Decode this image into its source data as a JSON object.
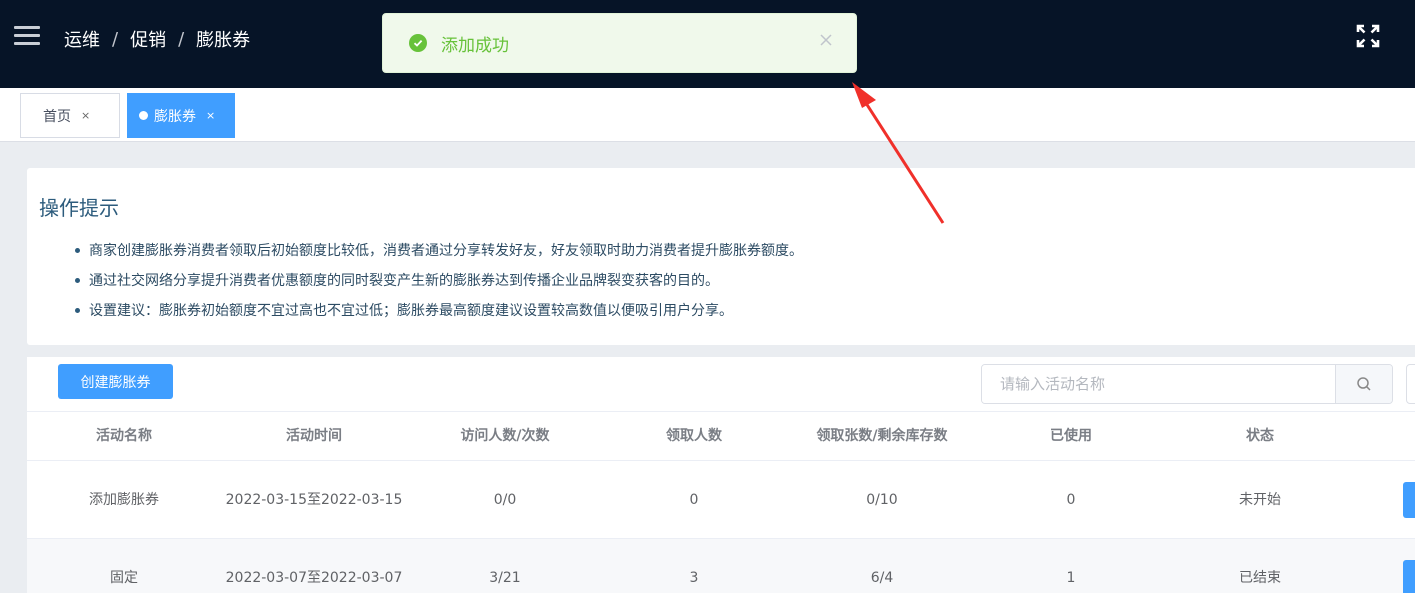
{
  "header": {
    "breadcrumb": [
      "运维",
      "促销",
      "膨胀券"
    ],
    "separator": "/",
    "bg_color": "#061427"
  },
  "toast": {
    "message": "添加成功",
    "type": "success",
    "color": "#67c23a"
  },
  "tabs": [
    {
      "label": "首页",
      "close": "×",
      "active": false
    },
    {
      "label": "膨胀券",
      "close": "×",
      "active": true
    }
  ],
  "tips": {
    "title": "操作提示",
    "items": [
      "商家创建膨胀券消费者领取后初始额度比较低，消费者通过分享转发好友，好友领取时助力消费者提升膨胀券额度。",
      "通过社交网络分享提升消费者优惠额度的同时裂变产生新的膨胀券达到传播企业品牌裂变获客的目的。",
      "设置建议：膨胀券初始额度不宜过高也不宜过低；膨胀券最高额度建议设置较高数值以便吸引用户分享。"
    ]
  },
  "toolbar": {
    "create_label": "创建膨胀券",
    "search_placeholder": "请输入活动名称",
    "accent": "#409eff"
  },
  "table": {
    "columns": [
      "活动名称",
      "活动时间",
      "访问人数/次数",
      "领取人数",
      "领取张数/剩余库存数",
      "已使用",
      "状态"
    ],
    "rows": [
      {
        "name": "添加膨胀券",
        "time": "2022-03-15至2022-03-15",
        "visits": "0/0",
        "receivers": "0",
        "received_stock": "0/10",
        "used": "0",
        "status": "未开始"
      },
      {
        "name": "固定",
        "time": "2022-03-07至2022-03-07",
        "visits": "3/21",
        "receivers": "3",
        "received_stock": "6/4",
        "used": "1",
        "status": "已结束"
      }
    ]
  }
}
